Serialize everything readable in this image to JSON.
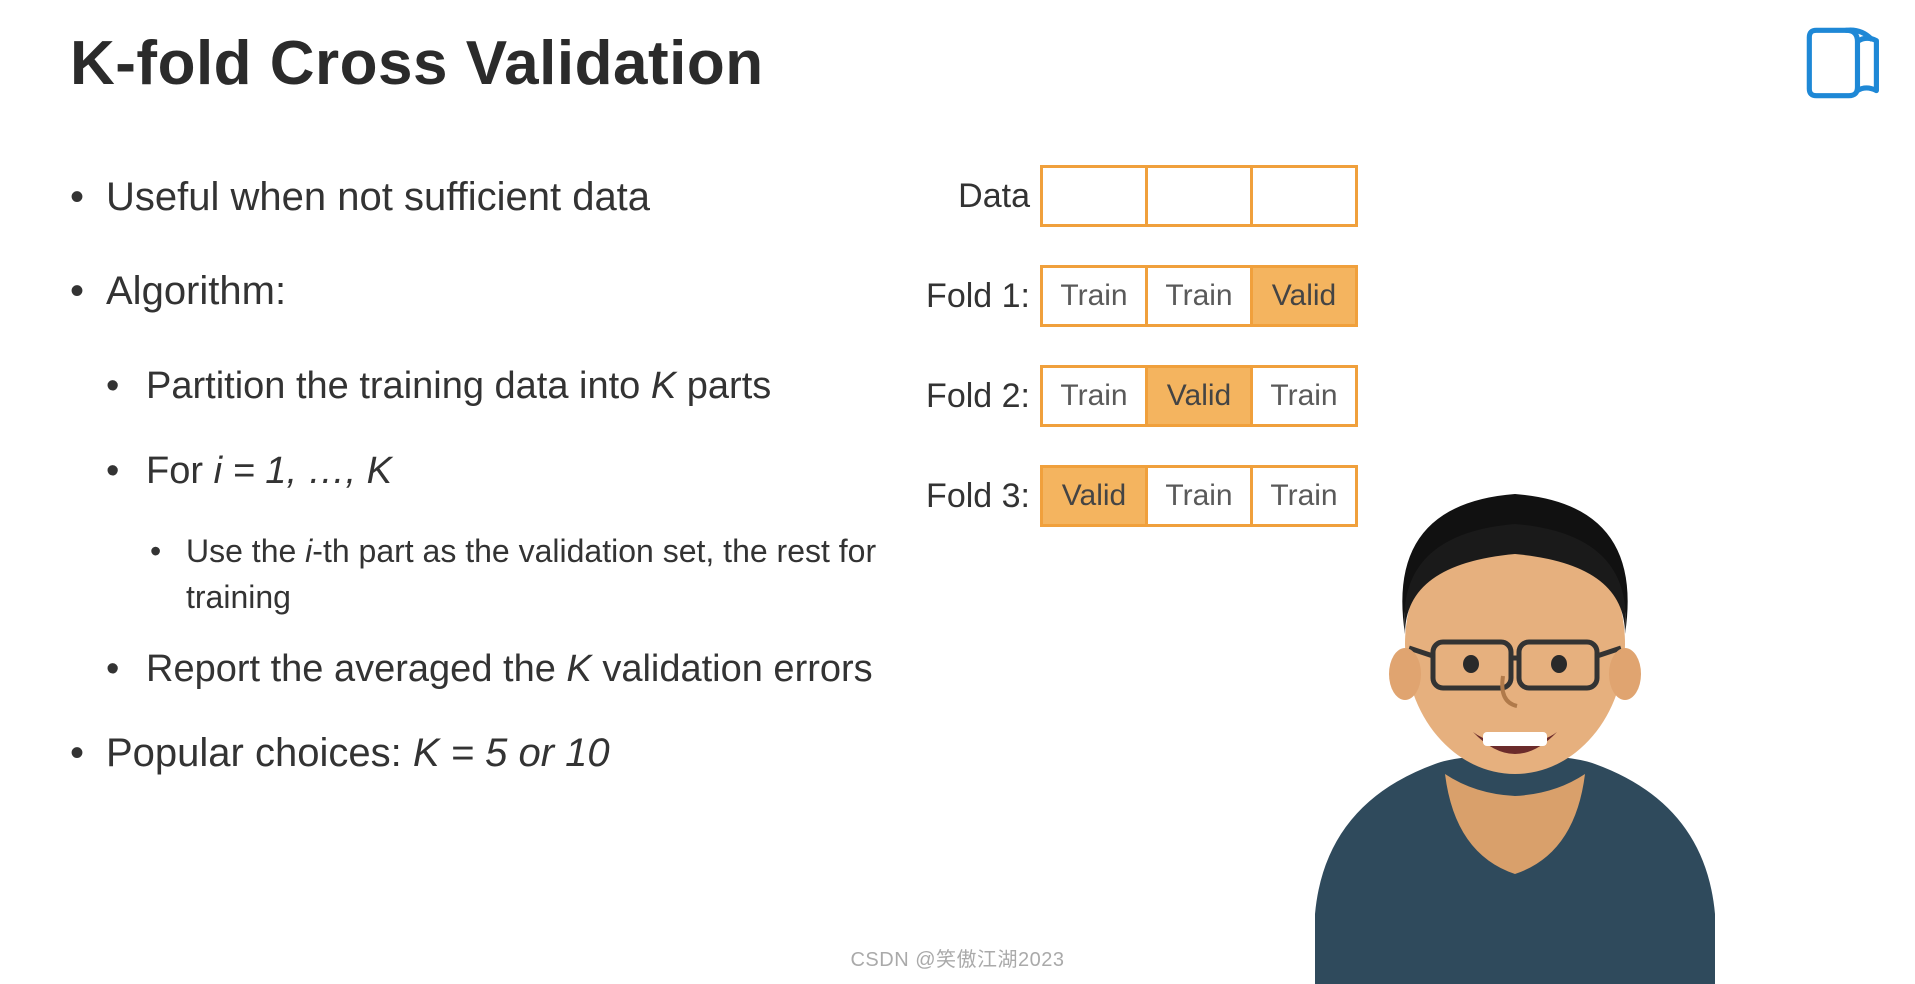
{
  "title": "K-fold Cross Validation",
  "bullets": {
    "b1": "Useful when not sufficient data",
    "b2": "Algorithm:",
    "b2a": "Partition the training data into ",
    "b2a_k": "K",
    "b2a_end": " parts",
    "b2b_pre": "For ",
    "b2b_i": "i = 1, …, K",
    "b2b1_pre": "Use the ",
    "b2b1_i": "i",
    "b2b1_post": "-th part as the validation set, the rest for training",
    "b2c_pre": "Report the averaged the ",
    "b2c_k": "K",
    "b2c_post": " validation errors",
    "b3_pre": "Popular choices: ",
    "b3_k": "K = 5 or 10"
  },
  "diagram": {
    "rows": [
      {
        "label": "Data",
        "cells": [
          "",
          "",
          ""
        ],
        "valid_index": -1
      },
      {
        "label": "Fold 1:",
        "cells": [
          "Train",
          "Train",
          "Valid"
        ],
        "valid_index": 2
      },
      {
        "label": "Fold 2:",
        "cells": [
          "Train",
          "Valid",
          "Train"
        ],
        "valid_index": 1
      },
      {
        "label": "Fold 3:",
        "cells": [
          "Valid",
          "Train",
          "Train"
        ],
        "valid_index": 0
      }
    ]
  },
  "watermark": "CSDN @笑傲江湖2023"
}
